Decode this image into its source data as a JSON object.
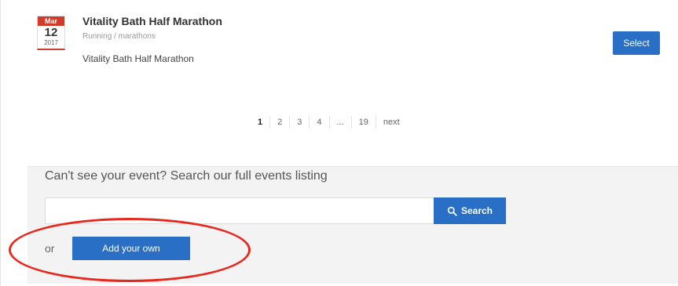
{
  "event": {
    "month": "Mar",
    "day": "12",
    "year": "2017",
    "title": "Vitality Bath Half Marathon",
    "category": "Running / marathons",
    "name": "Vitality Bath Half Marathon",
    "select_label": "Select"
  },
  "pagination": {
    "pages": [
      "1",
      "2",
      "3",
      "4",
      "...",
      "19"
    ],
    "current": "1",
    "next_label": "next"
  },
  "search": {
    "prompt": "Can't see your event? Search our full events listing",
    "input_value": "",
    "button_label": "Search",
    "button_icon": "search-icon"
  },
  "add": {
    "or_text": "or",
    "button_label": "Add your own"
  },
  "colors": {
    "primary": "#2a6fc6",
    "calendar_red": "#d23a2a",
    "highlight_red": "#e8281d"
  }
}
